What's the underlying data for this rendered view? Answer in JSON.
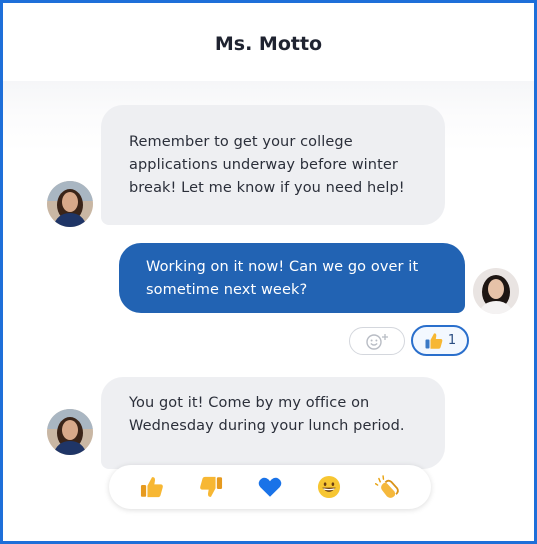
{
  "header": {
    "title": "Ms. Motto"
  },
  "messages": [
    {
      "sender": "teacher",
      "lines": [
        "Remember to get your college",
        "applications underway before winter",
        "break! Let me know if you need help!"
      ]
    },
    {
      "sender": "student",
      "lines": [
        "Working on it now! Can we go over it",
        "sometime next week?"
      ],
      "reaction": {
        "icon": "thumbs-up",
        "count": "1"
      }
    },
    {
      "sender": "teacher",
      "lines": [
        "You got it! Come by my office on",
        "Wednesday during your lunch period."
      ]
    }
  ],
  "reaction_bar": [
    "thumbs-up",
    "thumbs-down",
    "blue-heart",
    "grinning-face",
    "clapping-hands"
  ],
  "colors": {
    "frame": "#1e6fd9",
    "outgoing": "#2263b3",
    "incoming": "#eeeff2"
  }
}
